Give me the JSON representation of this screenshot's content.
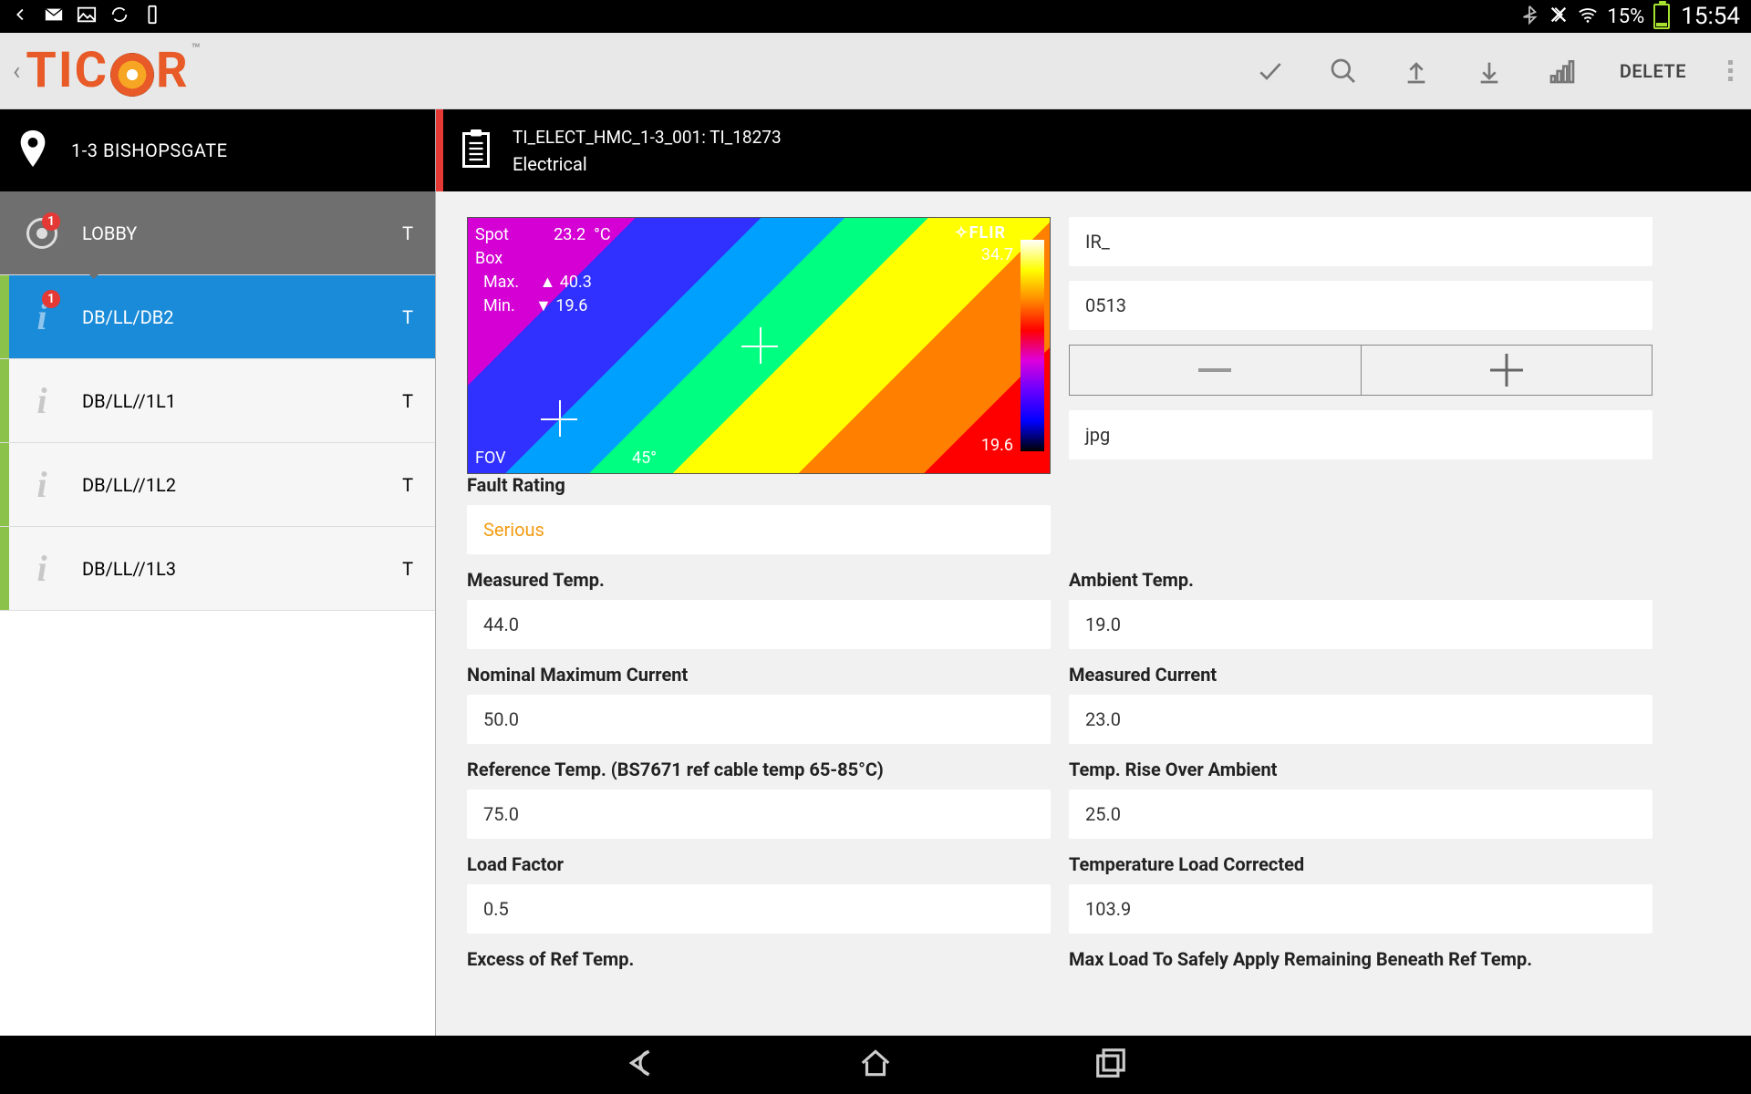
{
  "status": {
    "battery_pct": "15%",
    "time": "15:54"
  },
  "app": {
    "brand_pre": "TIC",
    "brand_post": "R",
    "delete_label": "DELETE"
  },
  "location": {
    "name": "1-3 BISHOPSGATE"
  },
  "sidebar": {
    "parent": {
      "label": "LOBBY",
      "type": "T",
      "badge": "1"
    },
    "items": [
      {
        "label": "DB/LL/DB2",
        "type": "T",
        "badge": "1",
        "active": true
      },
      {
        "label": "DB/LL//1L1",
        "type": "T"
      },
      {
        "label": "DB/LL//1L2",
        "type": "T"
      },
      {
        "label": "DB/LL//1L3",
        "type": "T"
      }
    ]
  },
  "doc": {
    "title": "TI_ELECT_HMC_1-3_001: TI_18273",
    "category": "Electrical"
  },
  "thermal": {
    "spot": "Spot",
    "box": "Box",
    "spot_val": "23.2",
    "unit": "°C",
    "max": "Max.",
    "max_val": "40.3",
    "min": "Min.",
    "min_val": "19.6",
    "brand": "FLIR",
    "scale_top": "34.7",
    "scale_bot": "19.6",
    "fov": "FOV",
    "angle": "45°"
  },
  "form": {
    "ir_prefix": "IR_",
    "ir_number": "0513",
    "ext": "jpg",
    "fault_rating": {
      "label": "Fault Rating",
      "value": "Serious"
    },
    "measured_temp": {
      "label": "Measured Temp.",
      "value": "44.0"
    },
    "ambient_temp": {
      "label": "Ambient Temp.",
      "value": "19.0"
    },
    "nominal_max_current": {
      "label": "Nominal Maximum Current",
      "value": "50.0"
    },
    "measured_current": {
      "label": "Measured Current",
      "value": "23.0"
    },
    "reference_temp": {
      "label": "Reference Temp. (BS7671 ref cable temp 65-85°C)",
      "value": "75.0"
    },
    "temp_rise": {
      "label": "Temp. Rise Over Ambient",
      "value": "25.0"
    },
    "load_factor": {
      "label": "Load Factor",
      "value": "0.5"
    },
    "temp_load_corrected": {
      "label": "Temperature Load Corrected",
      "value": "103.9"
    },
    "excess_ref": {
      "label": "Excess of Ref Temp."
    },
    "max_load": {
      "label": "Max Load To Safely Apply Remaining Beneath Ref Temp."
    }
  }
}
